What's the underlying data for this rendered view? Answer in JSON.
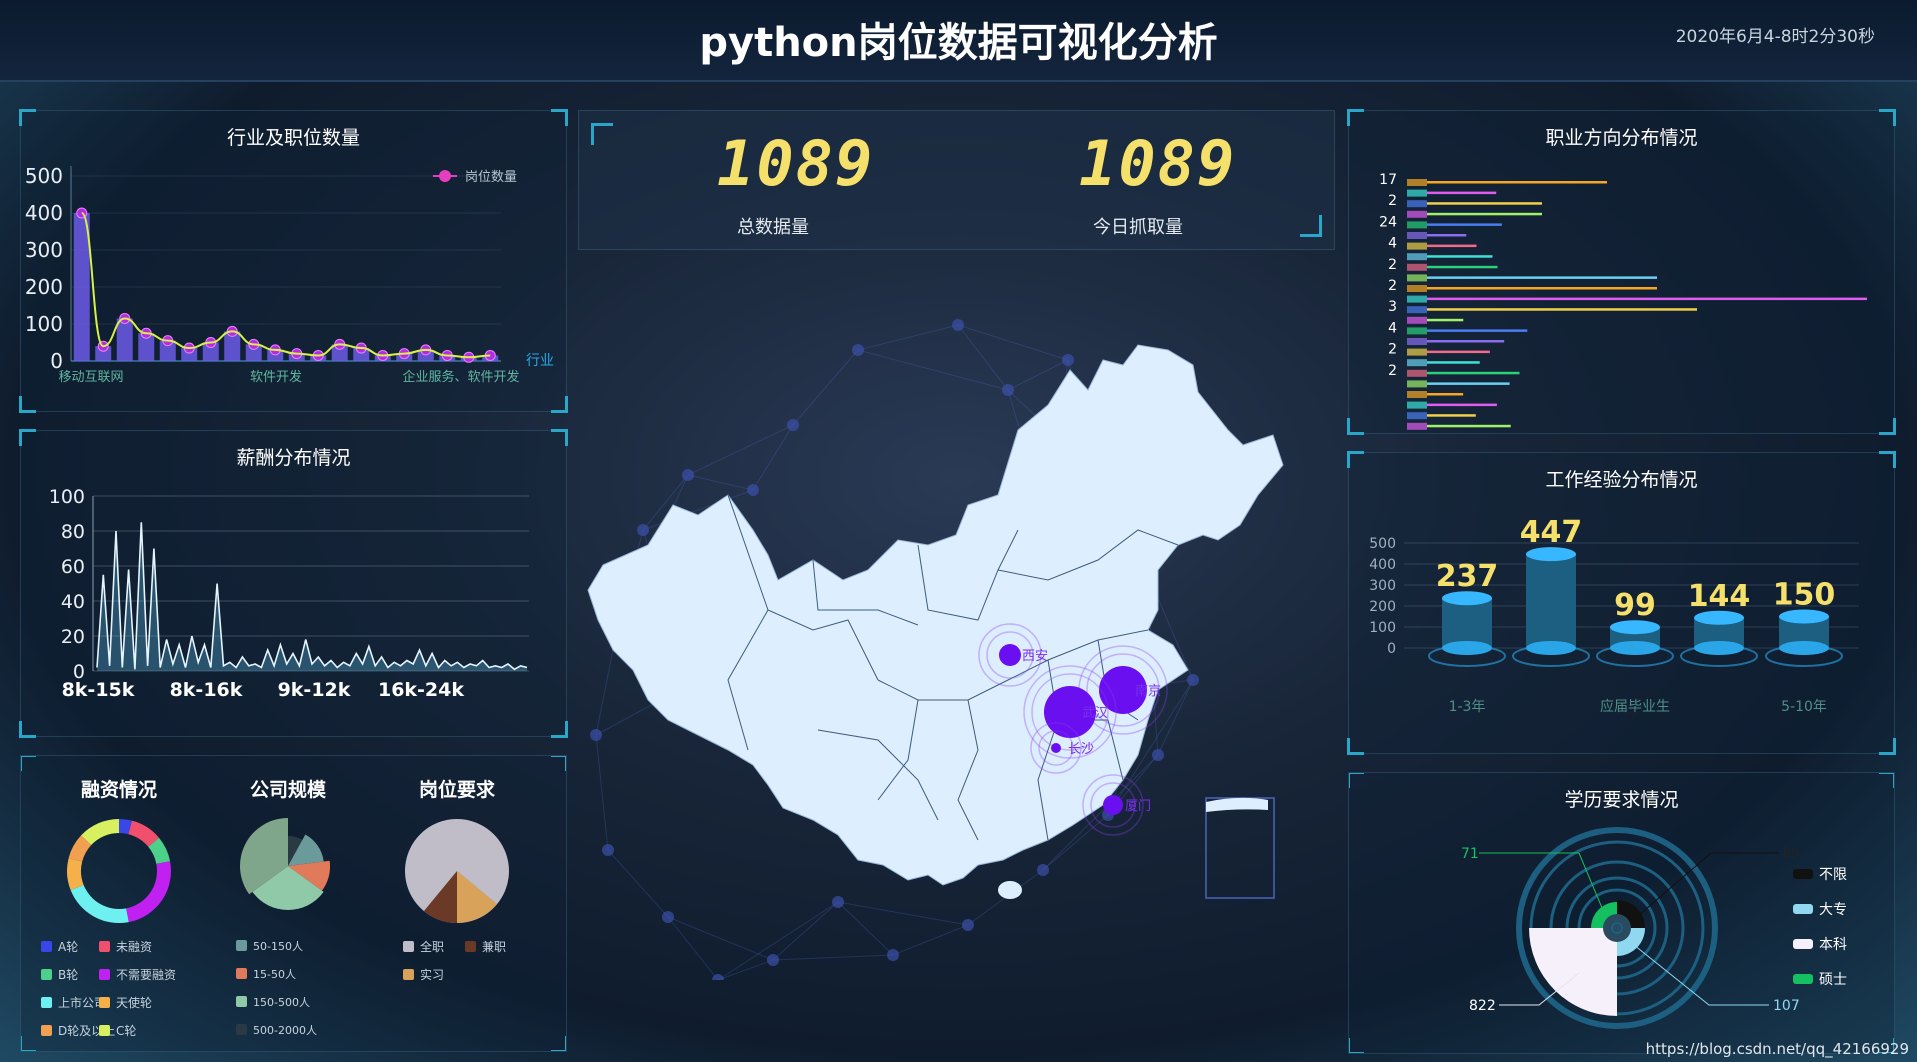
{
  "header": {
    "title": "python岗位数据可视化分析",
    "datetime": "2020年6月4-8时2分30秒"
  },
  "stats": {
    "total_value": "1089",
    "total_label": "总数据量",
    "today_value": "1089",
    "today_label": "今日抓取量"
  },
  "watermark": "https://blog.csdn.net/qq_42166929",
  "panels": {
    "industry": "行业及职位数量",
    "salary": "薪酬分布情况",
    "direction": "职业方向分布情况",
    "experience": "工作经验分布情况",
    "education": "学历要求情况"
  },
  "colors": {
    "accent": "#2aa6c9",
    "stat": "#f4e06b",
    "map_fill": "#ddeeff",
    "bubble": "#6a0ff0"
  },
  "chart_data": [
    {
      "id": "industry",
      "type": "bar",
      "title": "行业及职位数量",
      "xlabel": "行业",
      "ylim": [
        0,
        500
      ],
      "yticks": [
        0,
        100,
        200,
        300,
        400,
        500
      ],
      "category_labels": [
        "移动互联网",
        "软件开发",
        "企业服务、软件开发"
      ],
      "legend": "岗位数量",
      "values": [
        400,
        40,
        115,
        75,
        55,
        35,
        50,
        80,
        45,
        30,
        20,
        15,
        45,
        35,
        15,
        20,
        30,
        15,
        10,
        15
      ]
    },
    {
      "id": "salary",
      "type": "area",
      "title": "薪酬分布情况",
      "ylim": [
        0,
        100
      ],
      "yticks": [
        0,
        20,
        40,
        60,
        80,
        100
      ],
      "xticks": [
        "8k-15k",
        "8k-16k",
        "9k-12k",
        "16k-24k"
      ],
      "values": [
        2,
        55,
        3,
        80,
        2,
        58,
        1,
        85,
        3,
        70,
        2,
        18,
        4,
        15,
        2,
        20,
        5,
        15,
        2,
        50,
        3,
        5,
        2,
        8,
        3,
        4,
        2,
        12,
        3,
        15,
        4,
        10,
        3,
        18,
        4,
        8,
        3,
        6,
        2,
        5,
        3,
        10,
        4,
        14,
        3,
        8,
        2,
        5,
        3,
        6,
        4,
        12,
        3,
        10,
        2,
        6,
        3,
        5,
        2,
        4,
        3,
        6,
        2,
        3,
        2,
        4,
        1,
        3,
        2
      ]
    },
    {
      "id": "direction",
      "type": "bar",
      "title": "职业方向分布情况",
      "tick_labels": [
        "17",
        "2",
        "24",
        "4",
        "2",
        "2",
        "3",
        "4",
        "2",
        "2"
      ],
      "note": "horizontal multi-coloured bars"
    },
    {
      "id": "experience",
      "type": "bar",
      "title": "工作经验分布情况",
      "ylim": [
        0,
        500
      ],
      "yticks": [
        0,
        100,
        200,
        300,
        400,
        500
      ],
      "categories": [
        "1-3年",
        "",
        "应届毕业生",
        "",
        "5-10年"
      ],
      "values": [
        237,
        447,
        99,
        144,
        150
      ]
    },
    {
      "id": "finance",
      "type": "pie",
      "title": "融资情况",
      "legend": [
        "A轮",
        "未融资",
        "B轮",
        "不需要融资",
        "上市公司",
        "天使轮",
        "D轮及以上",
        "C轮"
      ],
      "colors": [
        "#3a47e8",
        "#f0506e",
        "#4dd08a",
        "#c020f0",
        "#6ef0f0",
        "#f5b04a",
        "#f0a050",
        "#d8f060"
      ]
    },
    {
      "id": "company_size",
      "type": "pie",
      "title": "公司规模",
      "legend": [
        "50-150人",
        "15-50人",
        "150-500人",
        "500-2000人"
      ],
      "colors": [
        "#6a9a9a",
        "#e07a5a",
        "#8fc9a8",
        "#2a3a45"
      ]
    },
    {
      "id": "job_type",
      "type": "pie",
      "title": "岗位要求",
      "legend": [
        "全职",
        "兼职",
        "实习"
      ],
      "colors": [
        "#c0bcc8",
        "#6a3a26",
        "#d8a25a"
      ]
    },
    {
      "id": "education",
      "type": "pie",
      "title": "学历要求情况",
      "legend": [
        "不限",
        "大专",
        "本科",
        "硕士"
      ],
      "values": [
        89,
        107,
        822,
        71
      ],
      "colors": [
        "#111111",
        "#8fd8f0",
        "#f5f0fa",
        "#15c060"
      ]
    },
    {
      "id": "map",
      "type": "scatter",
      "cities": [
        "西安",
        "南京",
        "武汉",
        "长沙",
        "厦门"
      ]
    }
  ]
}
